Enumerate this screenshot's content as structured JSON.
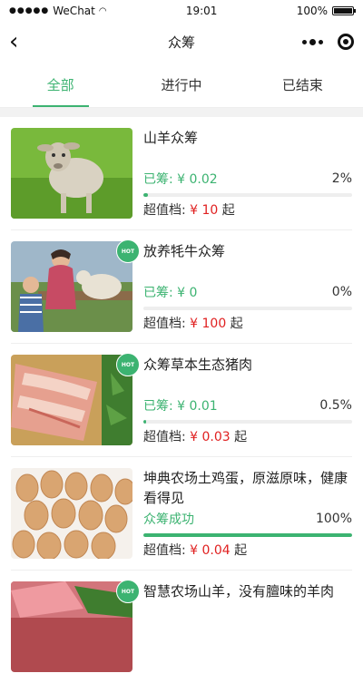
{
  "status_bar": {
    "carrier": "WeChat",
    "time": "19:01",
    "battery": "100%"
  },
  "nav": {
    "title": "众筹"
  },
  "tabs": [
    {
      "label": "全部",
      "active": true
    },
    {
      "label": "进行中",
      "active": false
    },
    {
      "label": "已结束",
      "active": false
    }
  ],
  "colors": {
    "accent": "#3cb371",
    "price": "#e02020",
    "progress_track": "#eeeeee"
  },
  "items": [
    {
      "title": "山羊众筹",
      "raised": "已筹: ¥ 0.02",
      "percent": "2%",
      "progress": 0.02,
      "price_label": "超值档: ",
      "price": "¥ 10",
      "price_suffix": " 起",
      "hot": false,
      "image": "sheep"
    },
    {
      "title": "放养牦牛众筹",
      "raised": "已筹: ¥ 0",
      "percent": "0%",
      "progress": 0,
      "price_label": "超值档: ",
      "price": "¥ 100",
      "price_suffix": " 起",
      "hot": true,
      "hot_text": "HOT",
      "image": "farm-visit"
    },
    {
      "title": "众筹草本生态猪肉",
      "raised": "已筹: ¥ 0.01",
      "percent": "0.5%",
      "progress": 0.005,
      "price_label": "超值档: ",
      "price": "¥ 0.03",
      "price_suffix": " 起",
      "hot": true,
      "hot_text": "HOT",
      "image": "pork"
    },
    {
      "title": "坤典农场土鸡蛋，原滋原味，健康看得见",
      "raised": "众筹成功",
      "percent": "100%",
      "progress": 1,
      "price_label": "超值档: ",
      "price": "¥ 0.04",
      "price_suffix": " 起",
      "hot": false,
      "image": "eggs"
    },
    {
      "title": "智慧农场山羊，没有膻味的羊肉",
      "hot": true,
      "hot_text": "HOT",
      "image": "meat"
    }
  ]
}
